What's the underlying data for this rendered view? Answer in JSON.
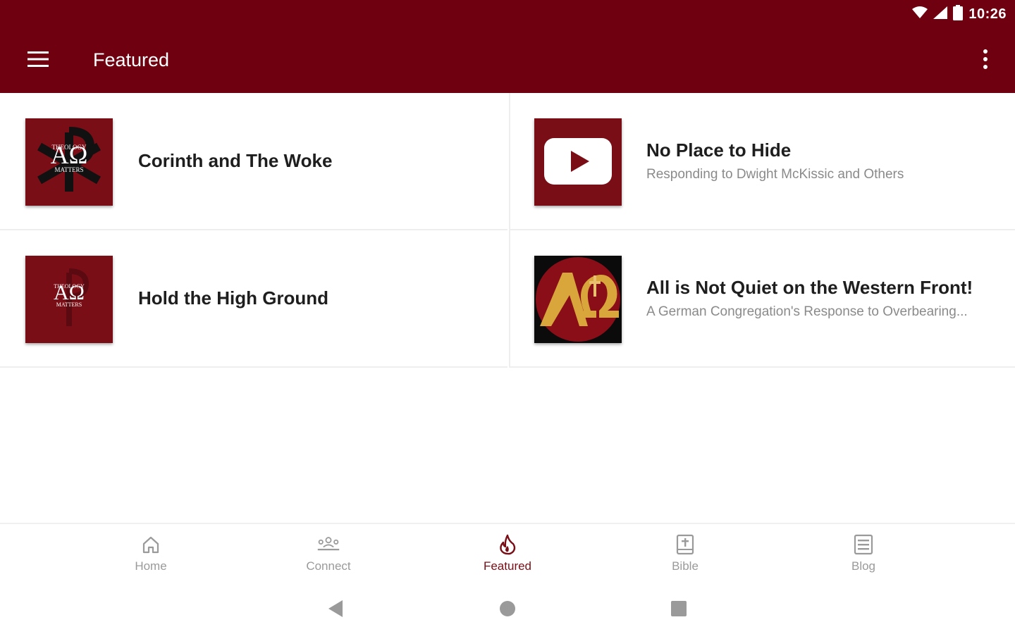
{
  "status_bar": {
    "time": "10:26"
  },
  "app_bar": {
    "title": "Featured"
  },
  "colors": {
    "brand": "#6e0010",
    "active": "#7a0e16",
    "inactive": "#9a9a9a"
  },
  "cards": [
    {
      "title": "Corinth and The Woke",
      "subtitle": "",
      "thumb": "theology-matters-logo"
    },
    {
      "title": "No Place to Hide",
      "subtitle": "Responding to Dwight McKissic and Others",
      "thumb": "youtube-play-icon"
    },
    {
      "title": "Hold the High Ground",
      "subtitle": "",
      "thumb": "theology-matters-logo"
    },
    {
      "title": "All is Not Quiet on the Western Front!",
      "subtitle": "A German Congregation's Response to Overbearing...",
      "thumb": "alpha-omega-cross-logo"
    }
  ],
  "logo_text": {
    "tm_top": "THEOLOGY",
    "tm_bottom": "MATTERS"
  },
  "bottom_nav": [
    {
      "label": "Home",
      "icon": "home-icon",
      "active": false
    },
    {
      "label": "Connect",
      "icon": "people-icon",
      "active": false
    },
    {
      "label": "Featured",
      "icon": "flame-icon",
      "active": true
    },
    {
      "label": "Bible",
      "icon": "bible-icon",
      "active": false
    },
    {
      "label": "Blog",
      "icon": "blog-icon",
      "active": false
    }
  ]
}
